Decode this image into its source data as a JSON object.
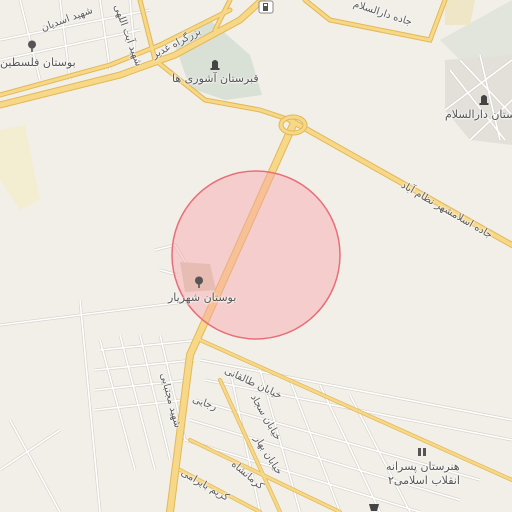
{
  "map": {
    "colors": {
      "background": "#f2efe9",
      "major_road": "#f7d788",
      "major_road_casing": "#e2b956",
      "minor_road": "#ffffff",
      "minor_road_casing": "#d8d4cc",
      "cemetery": "#d9e0d5",
      "park": "#c9b697",
      "radius_fill": "#f6a5a8",
      "radius_stroke": "#e86f78"
    },
    "selection_radius": {
      "shape": "circle"
    },
    "labels": {
      "bostan_shahriar": "بوستان شهریار",
      "qabrestan_ashouri": "قبرستان آشوری ها",
      "bostan_darossalam": "بوستان دارالسلام",
      "bostan_felestin": "بوستان فلسطین",
      "bozorgrah_ghadir": "بزرگراه غدیر",
      "jadde_darossalam": "جاده دارالسلام",
      "jadde_eslamshahr": "جاده اسلامشهر نظام آباد",
      "shahid_asadian": "شهید اسدیان",
      "shahid_ayatollahi": "شهید آیت اللهی",
      "shahid_mojtabai": "شهید مجتبایی",
      "khiaban_taleghani": "خیابان طالقانی",
      "khiaban_sajjad": "خیابان سجاد",
      "khiaban_bahar": "خیابان بهار",
      "kermanshahi": "کرمانشاه",
      "karim_bayrami": "کریم بایرامی",
      "rajaei": "رجایی",
      "school_line1": "هنرستان پسرانه",
      "school_line2": "انقلاب اسلامی۲"
    },
    "icons": {
      "park": "tree-icon",
      "cemetery": "tomb-icon",
      "fuel": "fuel-station-icon",
      "school": "school-icon",
      "shop": "basket-icon"
    }
  }
}
